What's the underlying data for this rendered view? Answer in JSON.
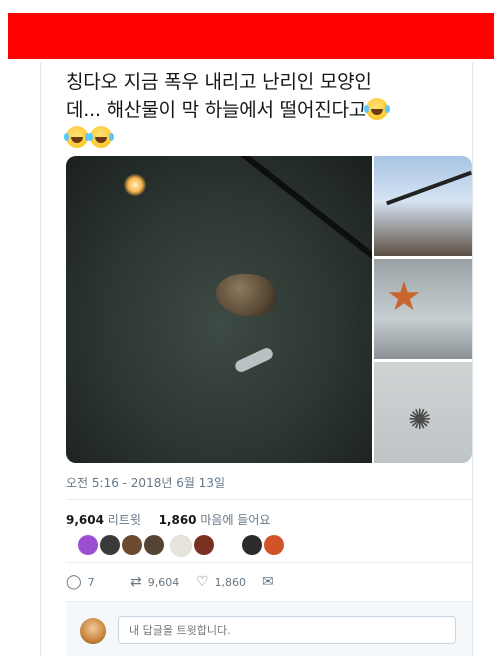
{
  "tweet": {
    "text_line1": "칭다오 지금 폭우 내리고 난리인 모양인",
    "text_line2": "데... 해산물이 막 하늘에서 떨어진다고",
    "emoji_name": "face-with-tears-of-joy"
  },
  "timestamp": "오전 5:16 - 2018년 6월 13일",
  "stats": {
    "retweets_count": "9,604",
    "retweets_label": "리트윗",
    "likes_count": "1,860",
    "likes_label": "마음에 들어요"
  },
  "liker_avatars": [
    {
      "color": "#9b4fd0"
    },
    {
      "color": "#3a3a3a"
    },
    {
      "color": "#6b4a2f"
    },
    {
      "color": "#554433"
    },
    {
      "color": "#e8e4dc"
    },
    {
      "color": "#7a3020"
    },
    {
      "color": "#2b2b2b"
    },
    {
      "color": "#d0532a"
    }
  ],
  "actions": {
    "reply_count": "7",
    "retweet_count": "9,604",
    "like_count": "1,860"
  },
  "reply": {
    "placeholder": "내 답글을 트윗합니다."
  },
  "colors": {
    "banner": "#ff0000",
    "muted": "#657786",
    "text": "#14171a"
  }
}
